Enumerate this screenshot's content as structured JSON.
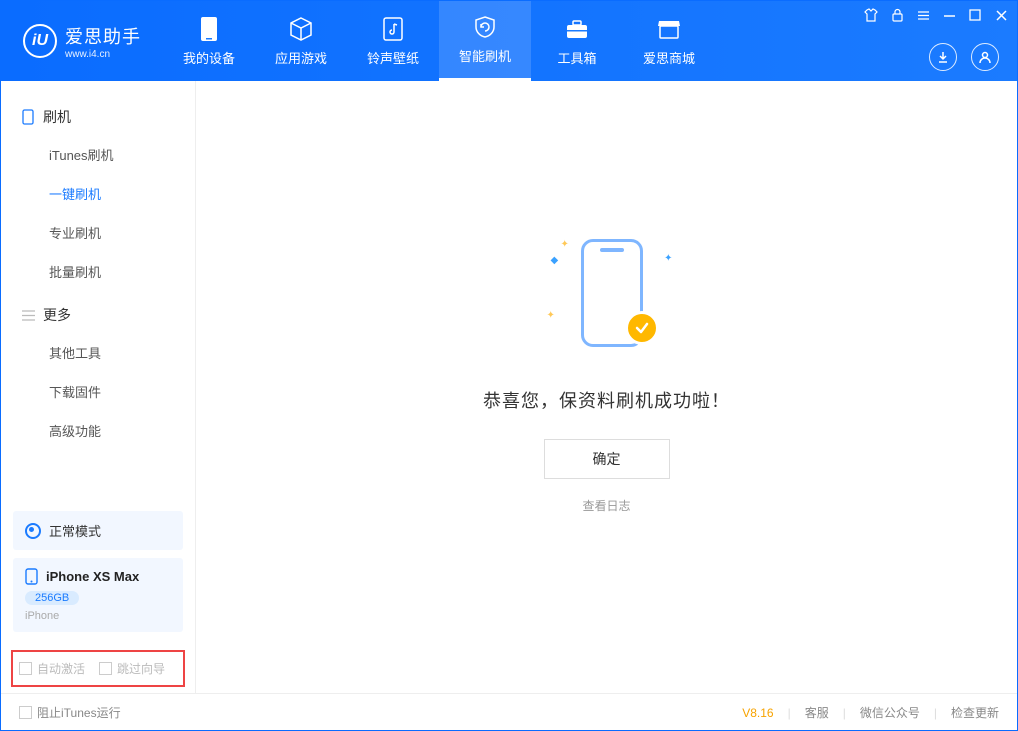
{
  "app": {
    "title": "爱思助手",
    "subtitle": "www.i4.cn",
    "logo_letter": "iU"
  },
  "nav": {
    "items": [
      {
        "label": "我的设备"
      },
      {
        "label": "应用游戏"
      },
      {
        "label": "铃声壁纸"
      },
      {
        "label": "智能刷机"
      },
      {
        "label": "工具箱"
      },
      {
        "label": "爱思商城"
      }
    ]
  },
  "sidebar": {
    "section1": {
      "title": "刷机",
      "items": [
        {
          "label": "iTunes刷机"
        },
        {
          "label": "一键刷机"
        },
        {
          "label": "专业刷机"
        },
        {
          "label": "批量刷机"
        }
      ]
    },
    "section2": {
      "title": "更多",
      "items": [
        {
          "label": "其他工具"
        },
        {
          "label": "下载固件"
        },
        {
          "label": "高级功能"
        }
      ]
    },
    "mode_label": "正常模式",
    "device": {
      "name": "iPhone XS Max",
      "storage": "256GB",
      "type": "iPhone"
    },
    "options": {
      "auto_activate": "自动激活",
      "skip_guide": "跳过向导"
    }
  },
  "main": {
    "success_text": "恭喜您，保资料刷机成功啦！",
    "ok_label": "确定",
    "log_link": "查看日志"
  },
  "footer": {
    "block_itunes": "阻止iTunes运行",
    "version": "V8.16",
    "links": {
      "support": "客服",
      "wechat": "微信公众号",
      "update": "检查更新"
    }
  }
}
